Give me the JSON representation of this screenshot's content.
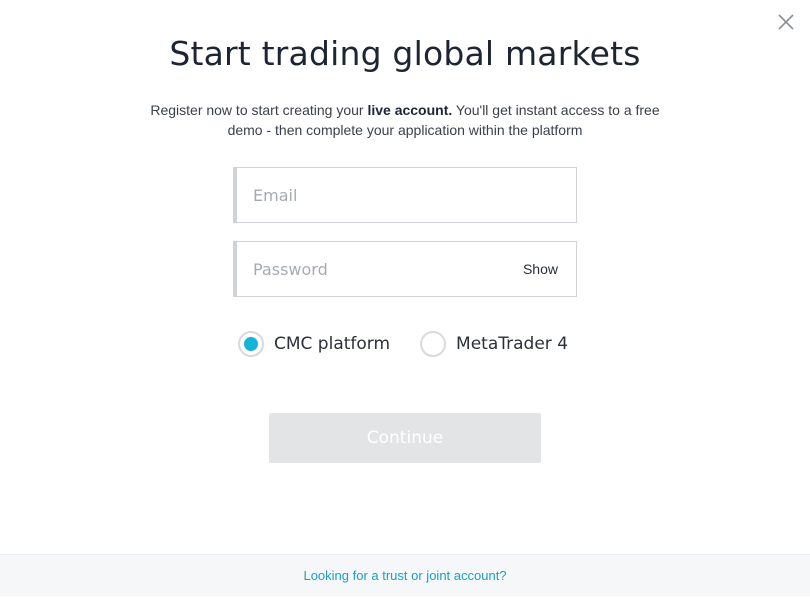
{
  "header": {
    "title": "Start trading global markets",
    "close_icon": "close-icon"
  },
  "intro": {
    "text_before": "Register now to start creating your ",
    "text_bold": "live account.",
    "text_after": " You'll get instant access to a free demo - then complete your application within the platform"
  },
  "form": {
    "email": {
      "placeholder": "Email",
      "value": ""
    },
    "password": {
      "placeholder": "Password",
      "value": "",
      "show_label": "Show"
    },
    "platform_options": [
      {
        "label": "CMC platform",
        "selected": true
      },
      {
        "label": "MetaTrader 4",
        "selected": false
      }
    ],
    "continue_label": "Continue"
  },
  "footer": {
    "link_text": "Looking for a trust or joint account?"
  },
  "colors": {
    "accent": "#14b4d6",
    "link": "#1a9fc4",
    "disabled_button": "#e3e4e6"
  }
}
